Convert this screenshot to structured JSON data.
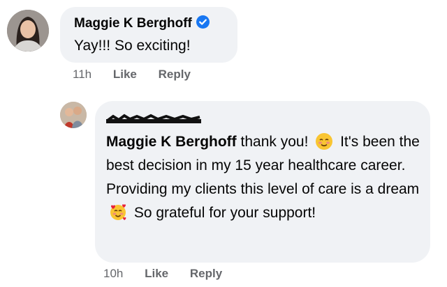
{
  "comment": {
    "author": "Maggie K Berghoff",
    "text": "Yay!!! So exciting!",
    "time": "11h",
    "like_label": "Like",
    "reply_label": "Reply"
  },
  "reply": {
    "mention": "Maggie K Berghoff",
    "text_a": " thank you! ",
    "text_b": " It's been the best decision in my 15 year healthcare career. Providing my clients this level of care is a dream ",
    "text_c": " So grateful for your support!",
    "emoji_1": "smiling-face-with-blush-icon",
    "emoji_2": "smiling-face-with-hearts-icon",
    "time": "10h",
    "like_label": "Like",
    "reply_label": "Reply"
  },
  "colors": {
    "bubble": "#f0f2f5",
    "verified": "#1877f2",
    "meta": "#65676b",
    "text": "#050505"
  }
}
